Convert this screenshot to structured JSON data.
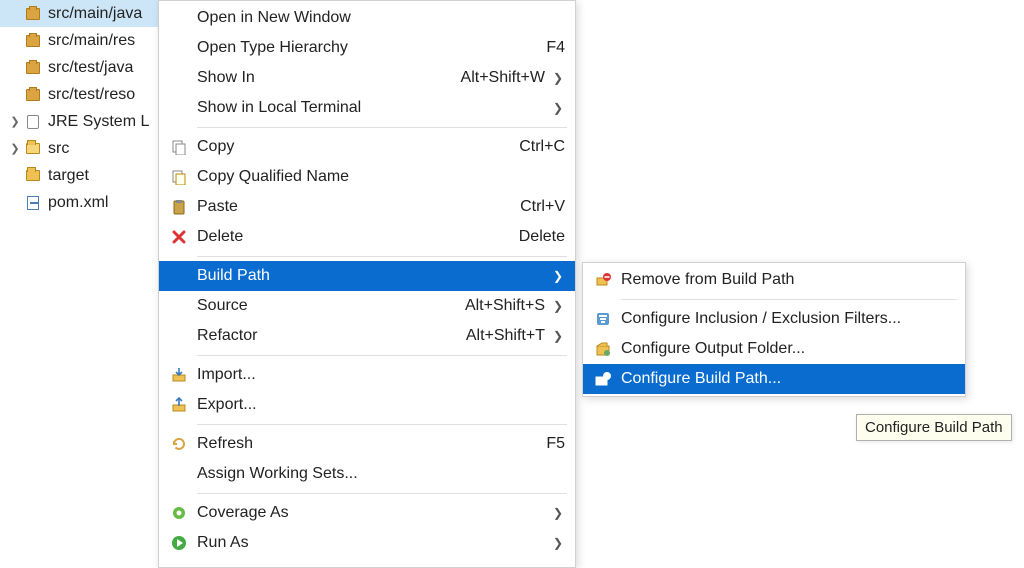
{
  "tree": {
    "items": [
      {
        "label": "src/main/java",
        "icon": "pkg",
        "indent": 1,
        "selected": true
      },
      {
        "label": "src/main/res",
        "icon": "pkg",
        "indent": 1
      },
      {
        "label": "src/test/java",
        "icon": "pkg",
        "indent": 1
      },
      {
        "label": "src/test/reso",
        "icon": "pkg",
        "indent": 1
      },
      {
        "label": "JRE System L",
        "icon": "jar",
        "indent": 1,
        "expander": ">"
      },
      {
        "label": "src",
        "icon": "fld-open",
        "indent": 1,
        "expander": ">"
      },
      {
        "label": "target",
        "icon": "fld",
        "indent": 1
      },
      {
        "label": "pom.xml",
        "icon": "xml",
        "indent": 1
      }
    ]
  },
  "mainMenu": {
    "items": [
      {
        "type": "item",
        "label": "Open in New Window",
        "icon": ""
      },
      {
        "type": "item",
        "label": "Open Type Hierarchy",
        "accel": "F4"
      },
      {
        "type": "item",
        "label": "Show In",
        "accel": "Alt+Shift+W",
        "arrow": true
      },
      {
        "type": "item",
        "label": "Show in Local Terminal",
        "arrow": true
      },
      {
        "type": "sep"
      },
      {
        "type": "item",
        "label": "Copy",
        "accel": "Ctrl+C",
        "icon": "copy"
      },
      {
        "type": "item",
        "label": "Copy Qualified Name",
        "icon": "copyq"
      },
      {
        "type": "item",
        "label": "Paste",
        "accel": "Ctrl+V",
        "icon": "paste"
      },
      {
        "type": "item",
        "label": "Delete",
        "accel": "Delete",
        "icon": "delete"
      },
      {
        "type": "sep"
      },
      {
        "type": "item",
        "label": "Build Path",
        "arrow": true,
        "highlight": true
      },
      {
        "type": "item",
        "label": "Source",
        "accel": "Alt+Shift+S",
        "arrow": true
      },
      {
        "type": "item",
        "label": "Refactor",
        "accel": "Alt+Shift+T",
        "arrow": true
      },
      {
        "type": "sep"
      },
      {
        "type": "item",
        "label": "Import...",
        "icon": "import"
      },
      {
        "type": "item",
        "label": "Export...",
        "icon": "export"
      },
      {
        "type": "sep"
      },
      {
        "type": "item",
        "label": "Refresh",
        "accel": "F5",
        "icon": "refresh"
      },
      {
        "type": "item",
        "label": "Assign Working Sets..."
      },
      {
        "type": "sep"
      },
      {
        "type": "item",
        "label": "Coverage As",
        "arrow": true,
        "icon": "coverage"
      },
      {
        "type": "item",
        "label": "Run As",
        "arrow": true,
        "icon": "run"
      }
    ]
  },
  "subMenu": {
    "items": [
      {
        "type": "item",
        "label": "Remove from Build Path",
        "icon": "remove"
      },
      {
        "type": "sep"
      },
      {
        "type": "item",
        "label": "Configure Inclusion / Exclusion Filters...",
        "icon": "filter"
      },
      {
        "type": "item",
        "label": "Configure Output Folder...",
        "icon": "output"
      },
      {
        "type": "item",
        "label": "Configure Build Path...",
        "icon": "buildpath",
        "highlight": true
      }
    ]
  },
  "tooltip": {
    "text": "Configure Build Path"
  }
}
